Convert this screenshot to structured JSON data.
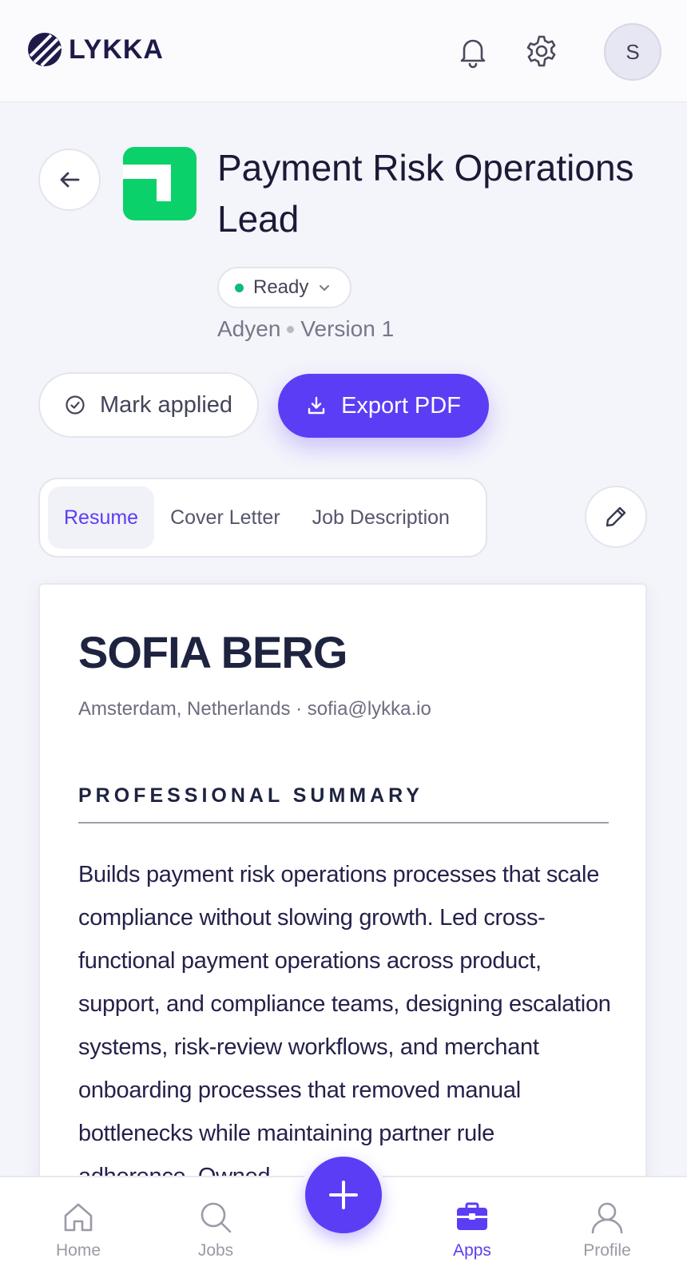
{
  "brand": {
    "name": "LYKKA",
    "accent": "#5b3df5",
    "success": "#10b981",
    "company_logo_color": "#0bd16a"
  },
  "header": {
    "avatar_initial": "S",
    "icons": [
      "bell-icon",
      "gear-icon"
    ]
  },
  "job": {
    "title": "Payment Risk Operations Lead",
    "status": "Ready",
    "company": "Adyen",
    "version": "Version 1"
  },
  "actions": {
    "mark_applied": "Mark applied",
    "export_pdf": "Export PDF"
  },
  "tabs": [
    {
      "label": "Resume",
      "active": true
    },
    {
      "label": "Cover Letter",
      "active": false
    },
    {
      "label": "Job Description",
      "active": false
    }
  ],
  "resume": {
    "name": "SOFIA BERG",
    "contact": "Amsterdam, Netherlands · sofia@lykka.io",
    "section_title": "PROFESSIONAL SUMMARY",
    "summary": "Builds payment risk operations processes that scale compliance without slowing growth. Led cross-functional payment operations across product, support, and compliance teams, designing escalation systems, risk-review workflows, and merchant onboarding processes that removed manual bottlenecks while maintaining partner rule adherence. Owned"
  },
  "nav": [
    {
      "label": "Home",
      "icon": "home-icon",
      "active": false
    },
    {
      "label": "Jobs",
      "icon": "search-icon",
      "active": false
    },
    {
      "label": "Apps",
      "icon": "briefcase-icon",
      "active": true
    },
    {
      "label": "Profile",
      "icon": "user-icon",
      "active": false
    }
  ]
}
